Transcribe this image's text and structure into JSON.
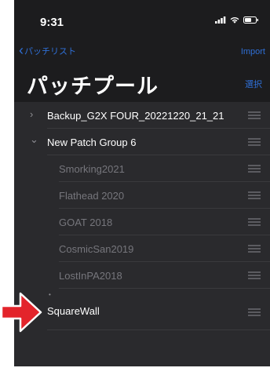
{
  "status": {
    "time": "9:31"
  },
  "nav": {
    "back_label": "パッチリスト",
    "import_label": "Import"
  },
  "header": {
    "title": "パッチプール",
    "select_label": "選択"
  },
  "list": {
    "group1": {
      "label": "Backup_G2X FOUR_20221220_21_21"
    },
    "group2": {
      "label": "New Patch Group 6",
      "children": [
        {
          "label": "Smorking2021"
        },
        {
          "label": "Flathead 2020"
        },
        {
          "label": "GOAT 2018"
        },
        {
          "label": "CosmicSan2019"
        },
        {
          "label": "LostInPA2018"
        }
      ]
    },
    "dragged": {
      "label": "SquareWall"
    }
  },
  "colors": {
    "accent": "#2f6fd6",
    "arrow": "#e3242b",
    "background": "#1c1c1e"
  }
}
